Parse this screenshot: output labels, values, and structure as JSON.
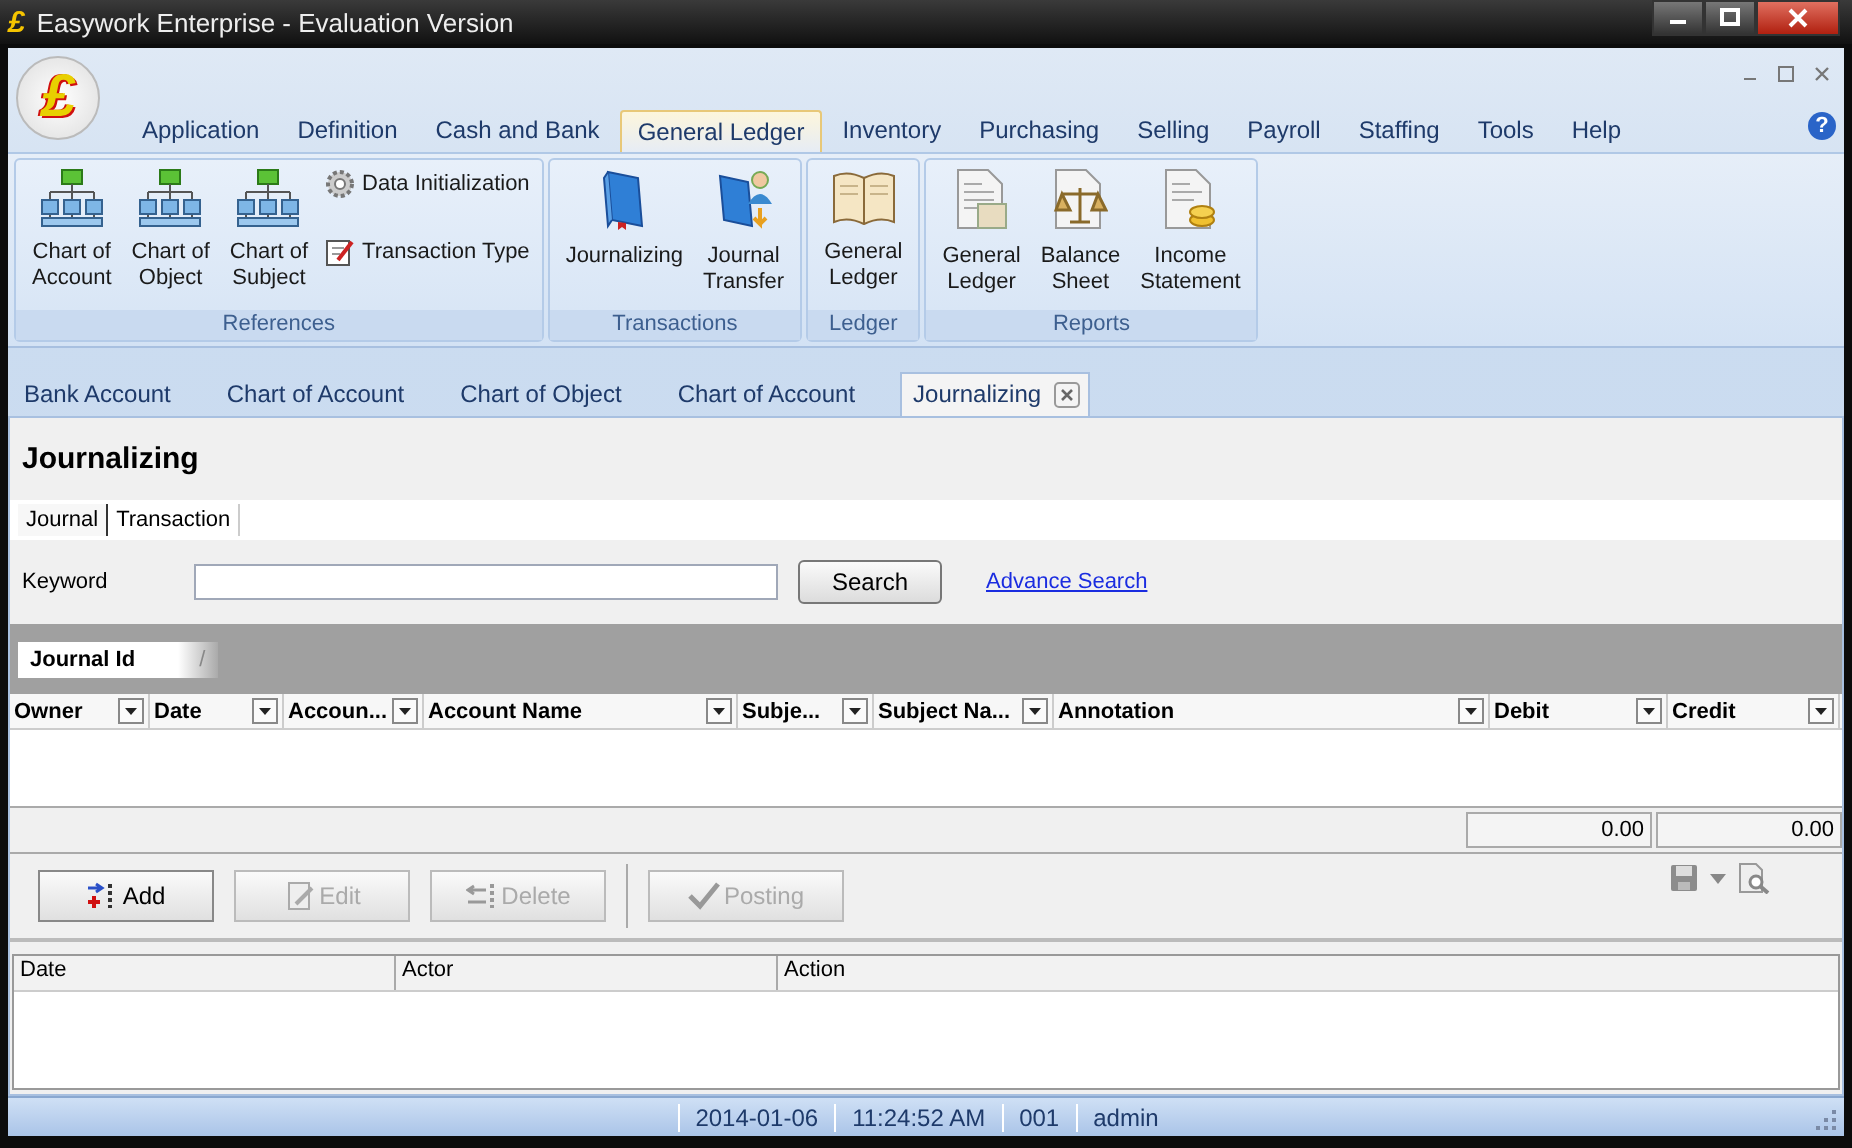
{
  "window": {
    "title": "Easywork Enterprise - Evaluation Version",
    "logo_mark": "£",
    "help_mark": "?"
  },
  "menu": [
    {
      "label": "Application",
      "selected": false
    },
    {
      "label": "Definition",
      "selected": false
    },
    {
      "label": "Cash and Bank",
      "selected": false
    },
    {
      "label": "General Ledger",
      "selected": true
    },
    {
      "label": "Inventory",
      "selected": false
    },
    {
      "label": "Purchasing",
      "selected": false
    },
    {
      "label": "Selling",
      "selected": false
    },
    {
      "label": "Payroll",
      "selected": false
    },
    {
      "label": "Staffing",
      "selected": false
    },
    {
      "label": "Tools",
      "selected": false
    },
    {
      "label": "Help",
      "selected": false
    }
  ],
  "ribbon": [
    {
      "title": "References",
      "items": [
        {
          "kind": "large",
          "lines": [
            "Chart of",
            "Account"
          ]
        },
        {
          "kind": "large",
          "lines": [
            "Chart of",
            "Object"
          ]
        },
        {
          "kind": "large",
          "lines": [
            "Chart of",
            "Subject"
          ]
        },
        {
          "kind": "small",
          "lines": [
            "Data Initialization"
          ]
        },
        {
          "kind": "small",
          "lines": [
            "Transaction Type"
          ]
        }
      ]
    },
    {
      "title": "Transactions",
      "items": [
        {
          "kind": "large",
          "lines": [
            "Journalizing"
          ]
        },
        {
          "kind": "large",
          "lines": [
            "Journal",
            "Transfer"
          ]
        }
      ]
    },
    {
      "title": "Ledger",
      "items": [
        {
          "kind": "large",
          "lines": [
            "General",
            "Ledger"
          ]
        }
      ]
    },
    {
      "title": "Reports",
      "items": [
        {
          "kind": "large",
          "lines": [
            "General",
            "Ledger"
          ]
        },
        {
          "kind": "large",
          "lines": [
            "Balance",
            "Sheet"
          ]
        },
        {
          "kind": "large",
          "lines": [
            "Income",
            "Statement"
          ]
        }
      ]
    }
  ],
  "doc_tabs": [
    {
      "label": "Bank Account",
      "selected": false
    },
    {
      "label": "Chart of Account",
      "selected": false
    },
    {
      "label": "Chart of Object",
      "selected": false
    },
    {
      "label": "Chart of Account",
      "selected": false
    },
    {
      "label": "Journalizing",
      "selected": true
    }
  ],
  "panel": {
    "title": "Journalizing",
    "sub_tabs": [
      {
        "label": "Journal",
        "selected": true
      },
      {
        "label": "Transaction",
        "selected": false
      }
    ],
    "keyword_label": "Keyword",
    "search_button": "Search",
    "advance_link": "Advance Search",
    "group_by": {
      "label": "Journal Id",
      "sort_mark": "/"
    },
    "columns": [
      "Owner",
      "Date",
      "Accoun...",
      "Account Name",
      "Subje...",
      "Subject Na...",
      "Annotation",
      "Debit",
      "Credit"
    ],
    "totals": [
      "0.00",
      "0.00"
    ],
    "buttons": [
      {
        "label": "Add",
        "disabled": false
      },
      {
        "label": "Edit",
        "disabled": true
      },
      {
        "label": "Delete",
        "disabled": true
      },
      {
        "label": "Posting",
        "disabled": true
      }
    ],
    "log_columns": [
      "Date",
      "Actor",
      "Action"
    ]
  },
  "status_bar": [
    "2014-01-06",
    "11:24:52 AM",
    "001",
    "admin"
  ]
}
